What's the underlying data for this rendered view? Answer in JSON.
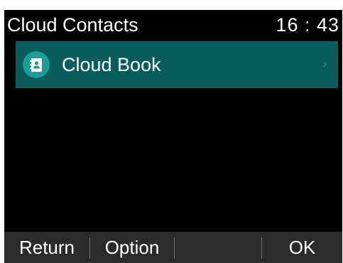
{
  "header": {
    "title": "Cloud Contacts",
    "time": "16 : 43"
  },
  "list": {
    "items": [
      {
        "label": "Cloud Book",
        "icon": "contact-book-icon",
        "chevron": "›",
        "selected": true
      }
    ]
  },
  "softkeys": {
    "key1": "Return",
    "key2": "Option",
    "key3": "",
    "key4": "OK"
  },
  "colors": {
    "background": "#000000",
    "selected_row": "#0b5c5c",
    "icon_circle": "#1b9e99",
    "softkey_bar": "#2b2b2b"
  }
}
